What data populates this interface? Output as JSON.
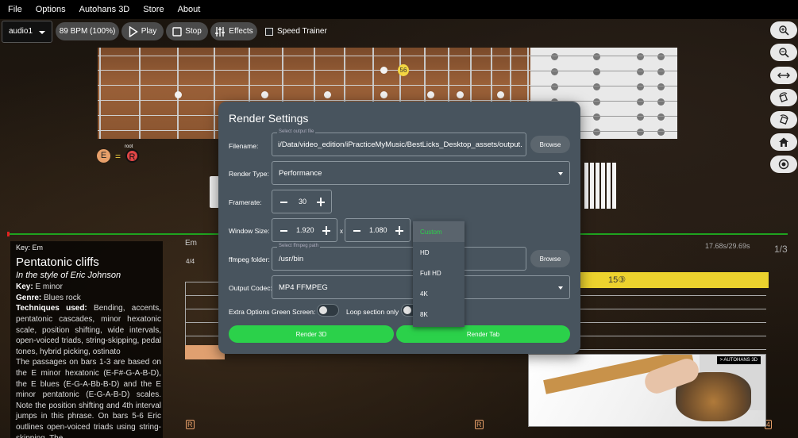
{
  "menubar": {
    "items": [
      "File",
      "Options",
      "Autohans 3D",
      "Store",
      "About"
    ]
  },
  "toolbar": {
    "audio_select": "audio1",
    "bpm_label": "89 BPM (100%)",
    "play_label": "Play",
    "stop_label": "Stop",
    "effects_label": "Effects",
    "speed_trainer_label": "Speed Trainer"
  },
  "right_tools": [
    "zoom-in-icon",
    "zoom-out-icon",
    "expand-horizontal-icon",
    "rotate-left-icon",
    "rotate-right-icon",
    "home-icon",
    "camera-icon"
  ],
  "fretboard": {
    "fret_marker_label": "56",
    "note": "E",
    "equals": "=",
    "root_label": "root",
    "root_note": "R"
  },
  "info": {
    "key_line": "Key: Em",
    "title": "Pentatonic cliffs",
    "style_line": "In the style of Eric Johnson",
    "key_label": "Key:",
    "key_value": "E minor",
    "genre_label": "Genre:",
    "genre_value": "Blues rock",
    "techniques_label": "Techniques used:",
    "techniques_value": "Bending, accents, pentatonic cascades, minor hexatonic scale, position shifting, wide intervals, open-voiced triads, string-skipping, pedal tones, hybrid picking, ostinato",
    "paragraph": "The passages on bars 1-3 are based on the E minor hexatonic (E-F#-G-A-B-D), the E blues (E-G-A-Bb-B-D) and the E minor pentatonic (E-G-A-B-D) scales. Note the position shifting and 4th interval jumps in this phrase. On bars 5-6 Eric outlines open-voiced triads using string-skipping. The"
  },
  "tab": {
    "chord": "Em",
    "time_sig": "4/4",
    "time": "17.68s/29.69s",
    "page": "1/3",
    "bar_note": "15③",
    "marker_r": "R",
    "marker_4": "4"
  },
  "video": {
    "label": "> AUTOHANS 3D"
  },
  "dialog": {
    "title": "Render Settings",
    "filename_label": "Filename:",
    "filename_legend": "Select output file",
    "filename_value": "i/Data/video_edition/iPracticeMyMusic/BestLicks_Desktop_assets/output.mp4",
    "browse_label": "Browse",
    "render_type_label": "Render Type:",
    "render_type_value": "Performance",
    "framerate_label": "Framerate:",
    "framerate_value": "30",
    "window_size_label": "Window Size:",
    "width_value": "1.920",
    "height_value": "1.080",
    "x_sep": "x",
    "ffmpeg_label": "ffmpeg folder:",
    "ffmpeg_legend": "Select ffmpeg path",
    "ffmpeg_value": "/usr/bin",
    "codec_label": "Output Codec:",
    "codec_value": "MP4 FFMPEG",
    "extra_label": "Extra Options",
    "green_screen_label": "Green Screen:",
    "loop_label": "Loop section only",
    "render3d_label": "Render 3D",
    "render_tab_label": "Render Tab"
  },
  "window_size_menu": {
    "options": [
      "Custom",
      "HD",
      "Full HD",
      "4K",
      "8K"
    ],
    "selected": "Custom"
  }
}
